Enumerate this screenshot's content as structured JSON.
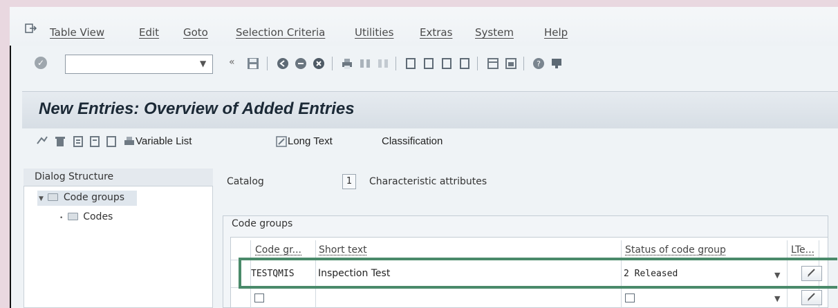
{
  "menu": {
    "items": [
      "Table View",
      "Edit",
      "Goto",
      "Selection Criteria",
      "Utilities",
      "Extras",
      "System",
      "Help"
    ]
  },
  "toolbar": {
    "command_field_value": "",
    "icons": [
      "enter-icon",
      "save-icon",
      "back-icon",
      "exit-icon",
      "cancel-icon",
      "print-icon",
      "find-icon",
      "find-next-icon",
      "first-page-icon",
      "previous-page-icon",
      "next-page-icon",
      "last-page-icon",
      "create-session-icon",
      "shortcut-icon",
      "help-icon",
      "customize-layout-icon"
    ]
  },
  "title": "New Entries: Overview of Added Entries",
  "app_toolbar": {
    "variable_list_label": "Variable List",
    "long_text_label": "Long Text",
    "classification_label": "Classification"
  },
  "dialog_structure": {
    "header": "Dialog Structure",
    "items": [
      "Code groups",
      "Codes"
    ]
  },
  "catalog": {
    "label": "Catalog",
    "value": "1",
    "description": "Characteristic attributes"
  },
  "code_groups": {
    "title": "Code groups",
    "columns": [
      "Code gr...",
      "Short text",
      "Status of code group",
      "LTe...",
      ""
    ],
    "rows": [
      {
        "code": "TESTQMIS",
        "short_text": "Inspection Test",
        "status": "2 Released"
      },
      {
        "code": "",
        "short_text": "",
        "status": ""
      }
    ]
  },
  "colors": {
    "highlight": "#4a8a6a",
    "background": "#eff3f6"
  }
}
